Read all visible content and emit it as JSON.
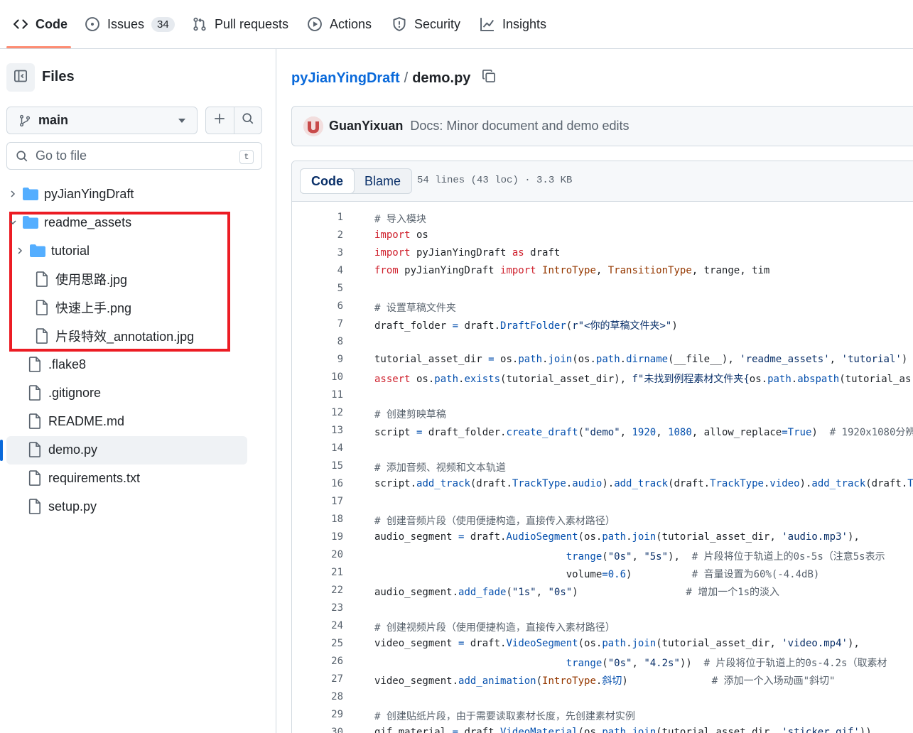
{
  "nav": {
    "tabs": [
      {
        "label": "Code",
        "icon": "code-icon"
      },
      {
        "label": "Issues",
        "icon": "issue-icon",
        "count": "34"
      },
      {
        "label": "Pull requests",
        "icon": "pull-request-icon"
      },
      {
        "label": "Actions",
        "icon": "play-icon"
      },
      {
        "label": "Security",
        "icon": "shield-icon"
      },
      {
        "label": "Insights",
        "icon": "graph-icon"
      }
    ]
  },
  "sidebar": {
    "title": "Files",
    "branch": "main",
    "goto_placeholder": "Go to file",
    "goto_shortcut": "t",
    "tree": [
      {
        "label": "pyJianYingDraft",
        "type": "folder",
        "expanded": false
      },
      {
        "label": "readme_assets",
        "type": "folder",
        "expanded": true
      },
      {
        "label": "tutorial",
        "type": "folder",
        "expanded": false
      },
      {
        "label": "使用思路.jpg",
        "type": "file"
      },
      {
        "label": "快速上手.png",
        "type": "file"
      },
      {
        "label": "片段特效_annotation.jpg",
        "type": "file"
      },
      {
        "label": ".flake8",
        "type": "file"
      },
      {
        "label": ".gitignore",
        "type": "file"
      },
      {
        "label": "README.md",
        "type": "file"
      },
      {
        "label": "demo.py",
        "type": "file",
        "selected": true
      },
      {
        "label": "requirements.txt",
        "type": "file"
      },
      {
        "label": "setup.py",
        "type": "file"
      }
    ]
  },
  "main": {
    "repo": "pyJianYingDraft",
    "separator": "/",
    "filename": "demo.py",
    "commit": {
      "author": "GuanYixuan",
      "message": "Docs: Minor document and demo edits"
    },
    "view_tabs": [
      "Code",
      "Blame"
    ],
    "file_meta": "54 lines (43 loc) · 3.3 KB"
  },
  "colors": {
    "accent": "#0969da",
    "tab_underline": "#fd8c73",
    "annotation": "#ec1c24"
  }
}
